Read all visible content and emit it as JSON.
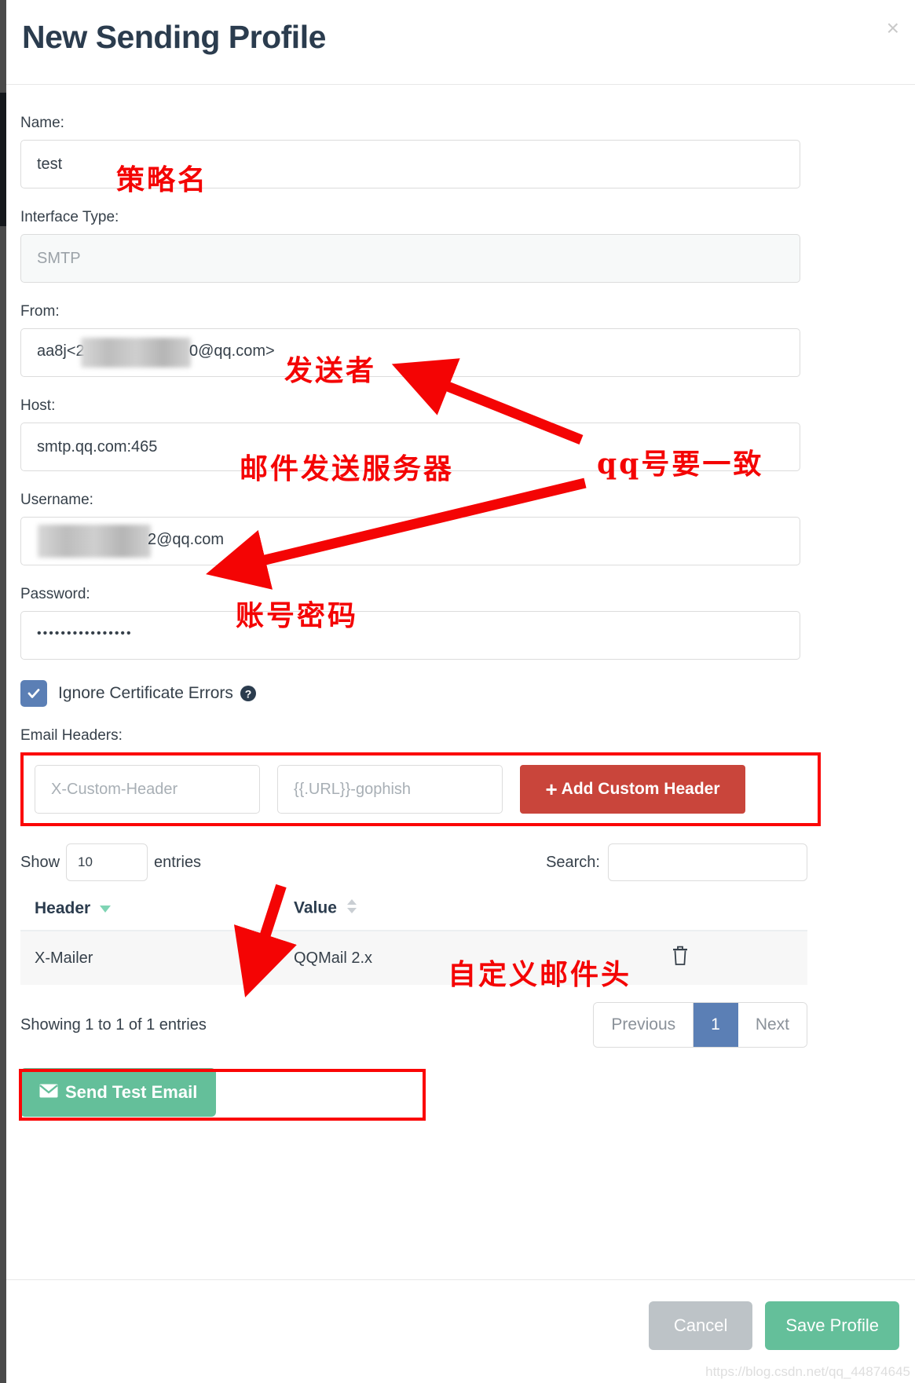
{
  "modal": {
    "title": "New Sending Profile",
    "close_icon": "close-icon"
  },
  "form": {
    "name_label": "Name:",
    "name_value": "test",
    "interface_label": "Interface Type:",
    "interface_value": "SMTP",
    "from_label": "From:",
    "from_value_prefix": "aa8j<2",
    "from_value_suffix": "0@qq.com>",
    "host_label": "Host:",
    "host_value": "smtp.qq.com:465",
    "username_label": "Username:",
    "username_value_suffix": "2@qq.com",
    "password_label": "Password:",
    "password_value": "••••••••••••••••",
    "ignore_cert_label": "Ignore Certificate Errors",
    "help_icon": "question-circle-icon"
  },
  "email_headers": {
    "section_label": "Email Headers:",
    "header_placeholder": "X-Custom-Header",
    "value_placeholder": "{{.URL}}-gophish",
    "add_button_label": "Add Custom Header",
    "add_button_icon": "plus-icon"
  },
  "table": {
    "show_label": "Show",
    "entries_label": "entries",
    "page_size": "10",
    "search_label": "Search:",
    "search_value": "",
    "columns": [
      "Header",
      "Value"
    ],
    "sort_icon_header": "caret-down-icon",
    "sort_icon_value": "sort-both-icon",
    "rows": [
      {
        "header": "X-Mailer",
        "value": "QQMail 2.x",
        "action_icon": "trash-icon"
      }
    ],
    "showing_text": "Showing 1 to 1 of 1 entries",
    "pagination": {
      "previous": "Previous",
      "pages": [
        "1"
      ],
      "current": "1",
      "next": "Next"
    }
  },
  "actions": {
    "send_test_label": "Send Test Email",
    "send_test_icon": "envelope-icon",
    "cancel_label": "Cancel",
    "save_label": "Save Profile"
  },
  "annotations": [
    {
      "id": "a1",
      "text": "策略名"
    },
    {
      "id": "a2",
      "text": "发送者"
    },
    {
      "id": "a3",
      "text": "邮件发送服务器"
    },
    {
      "id": "a4",
      "text": "qq号要一致"
    },
    {
      "id": "a5",
      "text": "账号密码"
    },
    {
      "id": "a6",
      "text": "自定义邮件头"
    }
  ],
  "watermark": "https://blog.csdn.net/qq_44874645",
  "colors": {
    "accent_blue": "#5b7fb5",
    "danger_red": "#c9453b",
    "annotation_red": "#f40404",
    "success_green": "#64bf9a",
    "title_navy": "#2b3c4e"
  }
}
